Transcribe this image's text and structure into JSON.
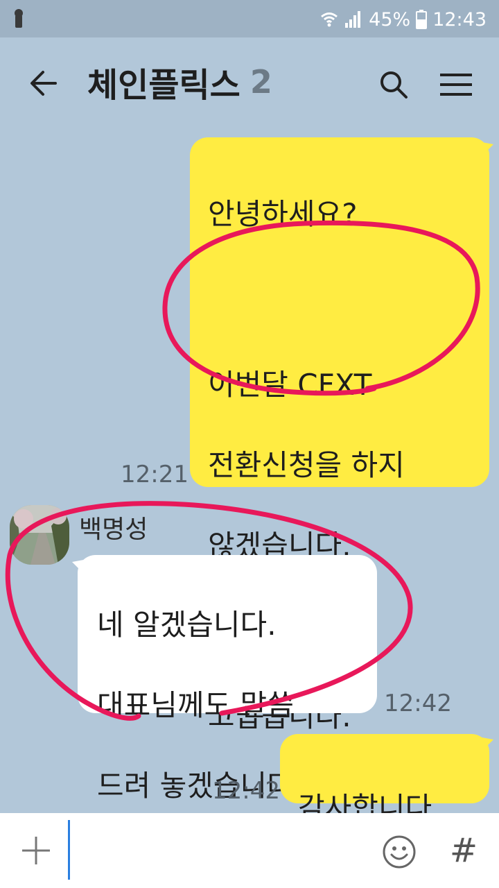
{
  "status_bar": {
    "battery": "45%",
    "time": "12:43",
    "icons": [
      "lock-icon",
      "wifi-icon",
      "signal-icon",
      "battery-icon"
    ]
  },
  "header": {
    "title": "체인플릭스",
    "member_count": "2",
    "icons": [
      "back-arrow-icon",
      "search-icon",
      "menu-icon"
    ]
  },
  "messages": [
    {
      "from": "me",
      "lines": [
        "안녕하세요?",
        "이번달 CFXT",
        "전환신청을 하지",
        "않겠습니다.",
        "고맙습니다."
      ],
      "time": "12:21"
    },
    {
      "from": "other",
      "sender": "백명성",
      "lines": [
        "네 알겠습니다.",
        "대표님께도 말씀",
        "드려 놓겠습니다."
      ],
      "time": "12:42"
    },
    {
      "from": "me",
      "text": "감사합니다",
      "time": "12:42"
    }
  ],
  "input_bar": {
    "placeholder": "",
    "hash_label": "#",
    "icons": [
      "plus-icon",
      "emoji-icon"
    ]
  },
  "colors": {
    "background": "#b2c7d9",
    "my_bubble": "#ffec42",
    "their_bubble": "#ffffff",
    "annotation": "#e8185a"
  }
}
